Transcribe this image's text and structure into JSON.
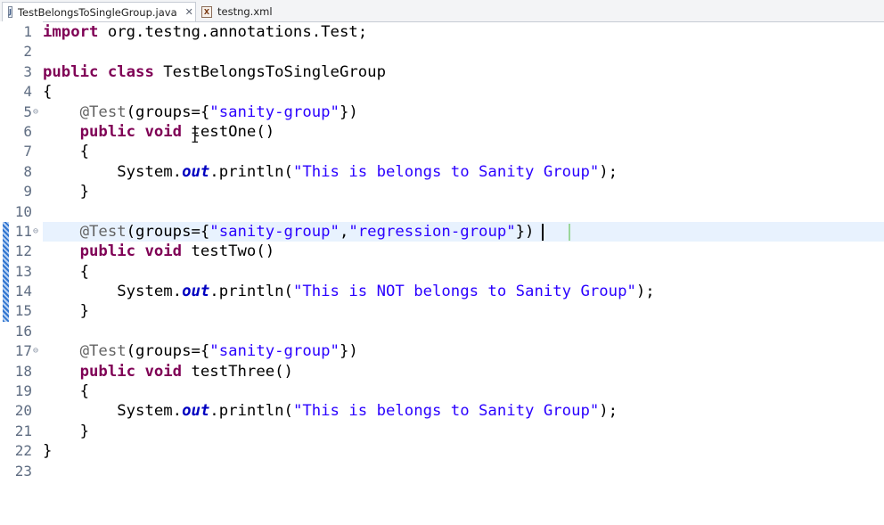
{
  "tabs": [
    {
      "label": "TestBelongsToSingleGroup.java",
      "icon": "java-file-icon",
      "icon_glyph": "J",
      "active": true
    },
    {
      "label": "testng.xml",
      "icon": "xml-file-icon",
      "icon_glyph": "X",
      "active": false
    }
  ],
  "close_glyph": "✕",
  "fold_glyph": "⊖",
  "cursor_glyph": "I",
  "colors": {
    "keyword": "#7f0055",
    "string": "#2a00ff",
    "annotation": "#646464",
    "field": "#0000c0",
    "current_line": "#e8f2fe",
    "line_number": "#5f6d82"
  },
  "editor": {
    "current_line": 11,
    "changed_lines": [
      11,
      15
    ],
    "lines": [
      {
        "n": "1",
        "fold": false,
        "tokens": [
          {
            "t": "kw",
            "v": "import"
          },
          {
            "t": "p",
            "v": " org.testng.annotations.Test;"
          }
        ]
      },
      {
        "n": "2",
        "fold": false,
        "tokens": []
      },
      {
        "n": "3",
        "fold": false,
        "tokens": [
          {
            "t": "kw",
            "v": "public"
          },
          {
            "t": "p",
            "v": " "
          },
          {
            "t": "kw",
            "v": "class"
          },
          {
            "t": "p",
            "v": " TestBelongsToSingleGroup"
          }
        ]
      },
      {
        "n": "4",
        "fold": false,
        "tokens": [
          {
            "t": "p",
            "v": "{"
          }
        ]
      },
      {
        "n": "5",
        "fold": true,
        "tokens": [
          {
            "t": "p",
            "v": "    "
          },
          {
            "t": "ann",
            "v": "@Test"
          },
          {
            "t": "p",
            "v": "(groups={"
          },
          {
            "t": "str",
            "v": "\"sanity-group\""
          },
          {
            "t": "p",
            "v": "})"
          }
        ]
      },
      {
        "n": "6",
        "fold": false,
        "tokens": [
          {
            "t": "p",
            "v": "    "
          },
          {
            "t": "kw",
            "v": "public"
          },
          {
            "t": "p",
            "v": " "
          },
          {
            "t": "kw",
            "v": "void"
          },
          {
            "t": "p",
            "v": " testOne()"
          }
        ]
      },
      {
        "n": "7",
        "fold": false,
        "tokens": [
          {
            "t": "p",
            "v": "    {"
          }
        ]
      },
      {
        "n": "8",
        "fold": false,
        "tokens": [
          {
            "t": "p",
            "v": "        System."
          },
          {
            "t": "fld",
            "v": "out"
          },
          {
            "t": "p",
            "v": ".println("
          },
          {
            "t": "str",
            "v": "\"This is belongs to Sanity Group\""
          },
          {
            "t": "p",
            "v": ");"
          }
        ]
      },
      {
        "n": "9",
        "fold": false,
        "tokens": [
          {
            "t": "p",
            "v": "    }"
          }
        ]
      },
      {
        "n": "10",
        "fold": false,
        "tokens": []
      },
      {
        "n": "11",
        "fold": true,
        "tokens": [
          {
            "t": "p",
            "v": "    "
          },
          {
            "t": "ann",
            "v": "@Test"
          },
          {
            "t": "p",
            "v": "(groups={"
          },
          {
            "t": "str",
            "v": "\"sanity-group\""
          },
          {
            "t": "p",
            "v": ","
          },
          {
            "t": "str",
            "v": "\"regression-group\""
          },
          {
            "t": "p",
            "v": "})"
          }
        ]
      },
      {
        "n": "12",
        "fold": false,
        "tokens": [
          {
            "t": "p",
            "v": "    "
          },
          {
            "t": "kw",
            "v": "public"
          },
          {
            "t": "p",
            "v": " "
          },
          {
            "t": "kw",
            "v": "void"
          },
          {
            "t": "p",
            "v": " testTwo()"
          }
        ]
      },
      {
        "n": "13",
        "fold": false,
        "tokens": [
          {
            "t": "p",
            "v": "    {"
          }
        ]
      },
      {
        "n": "14",
        "fold": false,
        "tokens": [
          {
            "t": "p",
            "v": "        System."
          },
          {
            "t": "fld",
            "v": "out"
          },
          {
            "t": "p",
            "v": ".println("
          },
          {
            "t": "str",
            "v": "\"This is NOT belongs to Sanity Group\""
          },
          {
            "t": "p",
            "v": ");"
          }
        ]
      },
      {
        "n": "15",
        "fold": false,
        "tokens": [
          {
            "t": "p",
            "v": "    }"
          }
        ]
      },
      {
        "n": "16",
        "fold": false,
        "tokens": []
      },
      {
        "n": "17",
        "fold": true,
        "tokens": [
          {
            "t": "p",
            "v": "    "
          },
          {
            "t": "ann",
            "v": "@Test"
          },
          {
            "t": "p",
            "v": "(groups={"
          },
          {
            "t": "str",
            "v": "\"sanity-group\""
          },
          {
            "t": "p",
            "v": "})"
          }
        ]
      },
      {
        "n": "18",
        "fold": false,
        "tokens": [
          {
            "t": "p",
            "v": "    "
          },
          {
            "t": "kw",
            "v": "public"
          },
          {
            "t": "p",
            "v": " "
          },
          {
            "t": "kw",
            "v": "void"
          },
          {
            "t": "p",
            "v": " testThree()"
          }
        ]
      },
      {
        "n": "19",
        "fold": false,
        "tokens": [
          {
            "t": "p",
            "v": "    {"
          }
        ]
      },
      {
        "n": "20",
        "fold": false,
        "tokens": [
          {
            "t": "p",
            "v": "        System."
          },
          {
            "t": "fld",
            "v": "out"
          },
          {
            "t": "p",
            "v": ".println("
          },
          {
            "t": "str",
            "v": "\"This is belongs to Sanity Group\""
          },
          {
            "t": "p",
            "v": ");"
          }
        ]
      },
      {
        "n": "21",
        "fold": false,
        "tokens": [
          {
            "t": "p",
            "v": "    }"
          }
        ]
      },
      {
        "n": "22",
        "fold": false,
        "tokens": [
          {
            "t": "p",
            "v": "}"
          }
        ]
      },
      {
        "n": "23",
        "fold": false,
        "tokens": []
      }
    ]
  }
}
